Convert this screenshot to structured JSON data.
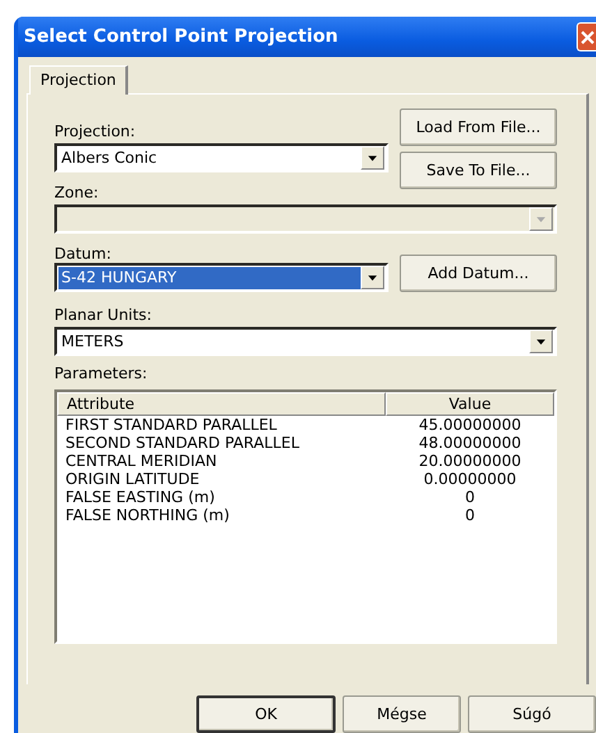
{
  "window": {
    "title": "Select Control Point Projection"
  },
  "tabs": [
    {
      "label": "Projection",
      "selected": true
    }
  ],
  "projection": {
    "label": "Projection:",
    "value": "Albers Conic",
    "disabled": false,
    "highlighted": false
  },
  "file_buttons": [
    "Load From File...",
    "Save To File..."
  ],
  "zone": {
    "label": "Zone:",
    "disabled": true
  },
  "datum": {
    "label": "Datum:",
    "value": "S-42 HUNGARY",
    "disabled": false,
    "highlighted": true,
    "button": "Add Datum..."
  },
  "planar_units": {
    "label": "Planar Units:",
    "value": "METERS",
    "disabled": false,
    "highlighted": false
  },
  "parameters": {
    "label": "Parameters:",
    "columns": [
      "Attribute",
      "Value"
    ],
    "rows": [
      [
        "FIRST STANDARD PARALLEL",
        "45.00000000"
      ],
      [
        "SECOND STANDARD PARALLEL",
        "48.00000000"
      ],
      [
        "CENTRAL MERIDIAN",
        "20.00000000"
      ],
      [
        "ORIGIN LATITUDE",
        "0.00000000"
      ],
      [
        "FALSE EASTING (m)",
        "0"
      ],
      [
        "FALSE NORTHING (m)",
        "0"
      ]
    ]
  },
  "buttons": [
    {
      "label": "OK",
      "default": true
    },
    {
      "label": "Mégse",
      "default": false
    },
    {
      "label": "Súgó",
      "default": false
    }
  ]
}
